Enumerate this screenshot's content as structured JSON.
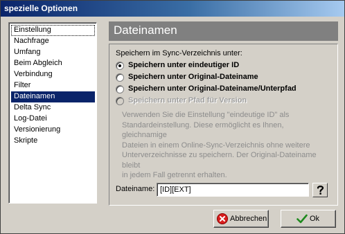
{
  "window": {
    "title": "spezielle Optionen"
  },
  "sidebar": {
    "items": [
      {
        "label": "Einstellung"
      },
      {
        "label": "Nachfrage"
      },
      {
        "label": "Umfang"
      },
      {
        "label": "Beim Abgleich"
      },
      {
        "label": "Verbindung"
      },
      {
        "label": "Filter"
      },
      {
        "label": "Dateinamen"
      },
      {
        "label": "Delta Sync"
      },
      {
        "label": "Log-Datei"
      },
      {
        "label": "Versionierung"
      },
      {
        "label": "Skripte"
      }
    ],
    "selected": "Dateinamen",
    "focused": "Einstellung"
  },
  "panel": {
    "title": "Dateinamen"
  },
  "group": {
    "label": "Speichern im Sync-Verzeichnis unter:",
    "options": [
      {
        "label": "Speichern unter eindeutiger ID",
        "checked": true,
        "enabled": true
      },
      {
        "label": "Speichern unter Original-Dateiname",
        "checked": false,
        "enabled": true
      },
      {
        "label": "Speichern unter Original-Dateiname/Unterpfad",
        "checked": false,
        "enabled": true
      },
      {
        "label": "Speichern unter Pfad für Version",
        "checked": false,
        "enabled": false
      }
    ],
    "info_lines": [
      "Verwenden Sie die Einstellung \"eindeutige ID\" als",
      "Standardeinstellung. Diese ermöglicht es Ihnen, gleichnamige",
      "Dateien in einem Online-Sync-Verzeichnis ohne weitere",
      "Unterverzeichnisse zu speichern. Der Original-Dateiname bleibt",
      "in jedem Fall getrennt erhalten."
    ]
  },
  "filename": {
    "label": "Dateiname:",
    "value": "[ID][EXT]"
  },
  "buttons": {
    "cancel_label": "Abbrechen",
    "ok_label": "Ok"
  },
  "colors": {
    "title_start": "#0a246a",
    "title_end": "#a6caf0",
    "selection": "#0a246a",
    "header_bg": "#808080",
    "face": "#d4d0c8"
  },
  "icons": {
    "help": "question-mark-icon",
    "cancel": "cancel-x-icon",
    "ok": "checkmark-icon"
  }
}
